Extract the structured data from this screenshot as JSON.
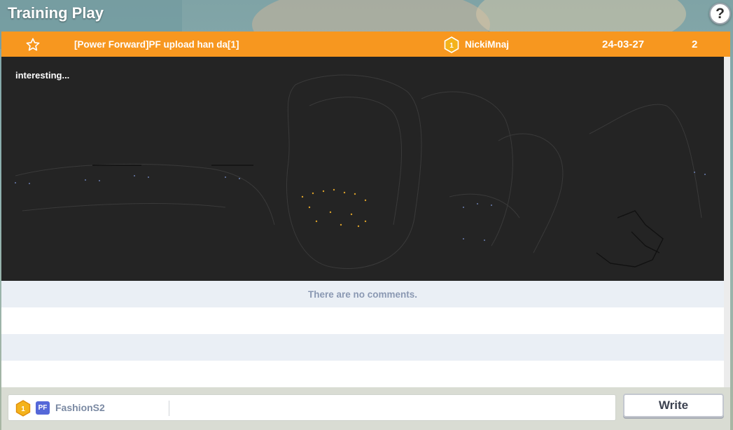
{
  "screen": {
    "title": "Training Play",
    "help_label": "?"
  },
  "post": {
    "title": "[Power Forward]PF upload han da[1]",
    "rank_badge": "1",
    "author": "NickiMnaj",
    "date": "24-03-27",
    "count": "2",
    "body": "interesting..."
  },
  "comments": {
    "empty_text": "There are no comments."
  },
  "composer": {
    "rank_badge": "1",
    "position_tag": "PF",
    "username": "FashionS2",
    "input_value": "",
    "write_label": "Write"
  },
  "colors": {
    "header_orange": "#f7971f",
    "badge_gold": "#f4b31b",
    "position_blue": "#5568d8",
    "video_bg": "#242424"
  },
  "icons": {
    "favorite": "star-outline-icon",
    "rank": "hexagon-rank-badge-icon",
    "help": "question-mark-icon"
  }
}
